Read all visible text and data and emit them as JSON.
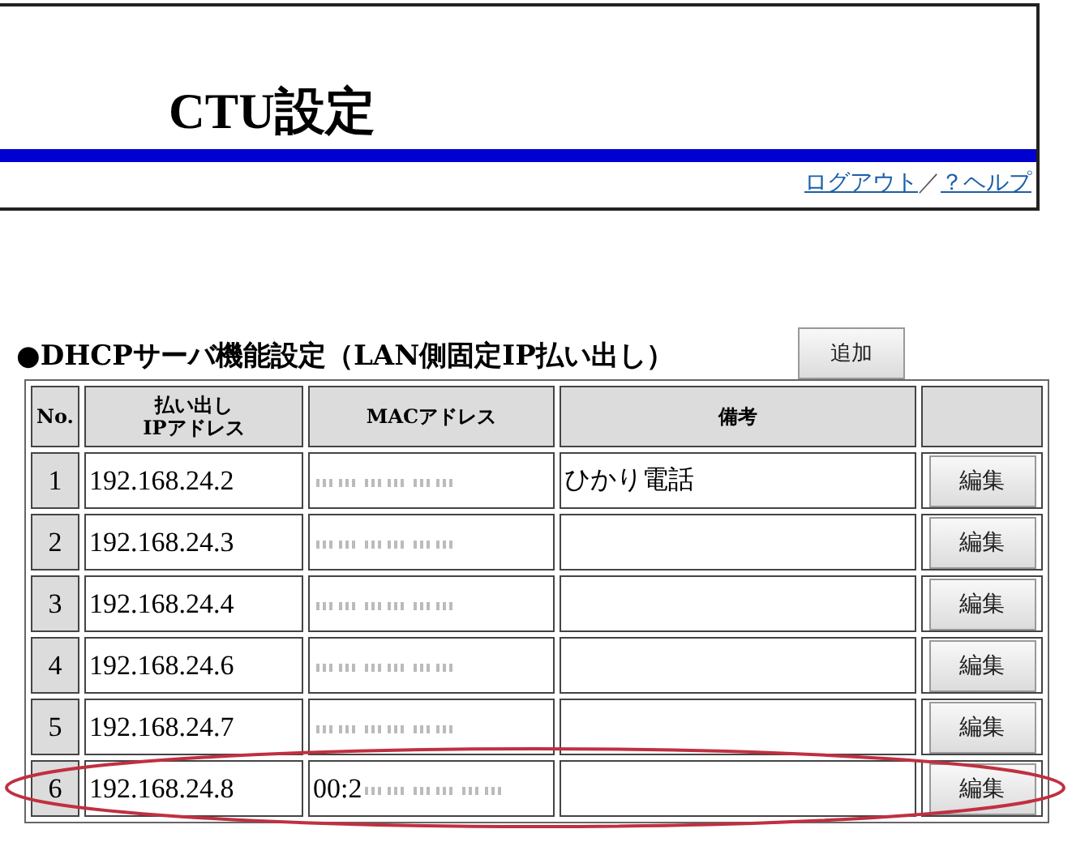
{
  "header": {
    "title": "CTU設定",
    "links": [
      {
        "label": "ログアウト"
      },
      {
        "label": "？ヘルプ"
      }
    ],
    "separator": "／"
  },
  "section": {
    "title": "●DHCPサーバ機能設定（LAN側固定IP払い出し）",
    "add_button": "追加"
  },
  "table": {
    "columns": [
      {
        "lines": [
          "No."
        ]
      },
      {
        "lines": [
          "払い出し",
          "IPアドレス"
        ]
      },
      {
        "lines": [
          "MACアドレス"
        ]
      },
      {
        "lines": [
          "備考"
        ]
      },
      {}
    ],
    "rows": [
      {
        "no": "1",
        "ip": "192.168.24.2",
        "mac_redacted": true,
        "note": "ひかり電話",
        "button": "編集",
        "highlighted": false
      },
      {
        "no": "2",
        "ip": "192.168.24.3",
        "mac_redacted": true,
        "button": "編集",
        "highlighted": false
      },
      {
        "no": "3",
        "ip": "192.168.24.4",
        "mac_redacted": true,
        "button": "編集",
        "highlighted": false
      },
      {
        "no": "4",
        "ip": "192.168.24.6",
        "mac_redacted": true,
        "button": "編集",
        "highlighted": false
      },
      {
        "no": "5",
        "ip": "192.168.24.7",
        "mac_redacted": true,
        "button": "編集",
        "highlighted": false
      },
      {
        "no": "6",
        "ip": "192.168.24.8",
        "mac": "00:2",
        "mac_redacted": true,
        "button": "編集",
        "highlighted": true
      }
    ]
  }
}
